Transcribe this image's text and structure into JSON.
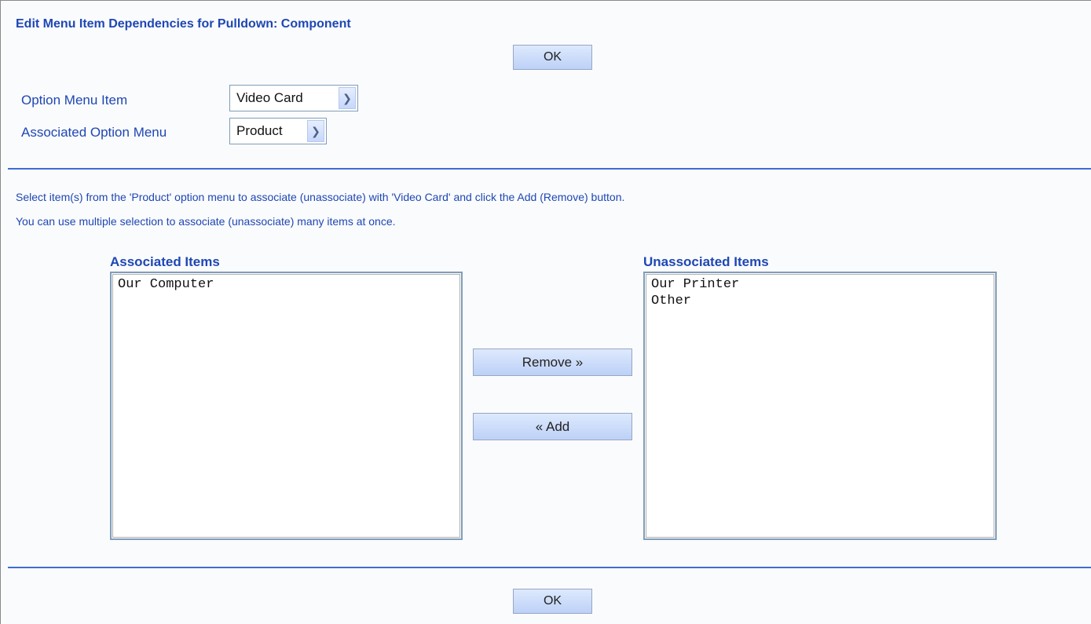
{
  "header": {
    "title": "Edit Menu Item Dependencies for Pulldown: Component",
    "ok_label": "OK"
  },
  "form": {
    "option_menu_item_label": "Option Menu Item",
    "option_menu_item_value": "Video Card",
    "associated_option_menu_label": "Associated Option Menu",
    "associated_option_menu_value": "Product"
  },
  "instructions": {
    "line1": "Select item(s) from the 'Product' option menu to associate (unassociate) with 'Video Card' and click the Add (Remove) button.",
    "line2": "You can use multiple selection to associate (unassociate) many items at once."
  },
  "associated": {
    "heading": "Associated Items",
    "items": [
      "Our Computer"
    ]
  },
  "unassociated": {
    "heading": "Unassociated Items",
    "items": [
      "Our Printer",
      "Other"
    ]
  },
  "actions": {
    "remove_label": "Remove »",
    "add_label": "« Add"
  },
  "footer": {
    "ok_label": "OK"
  },
  "colors": {
    "accent": "#1e47b4",
    "rule": "#3d6dd6",
    "button_top": "#dde9fd",
    "button_bottom": "#bdd1f7"
  },
  "icons": {
    "dropdown": "chevron-down-icon"
  }
}
